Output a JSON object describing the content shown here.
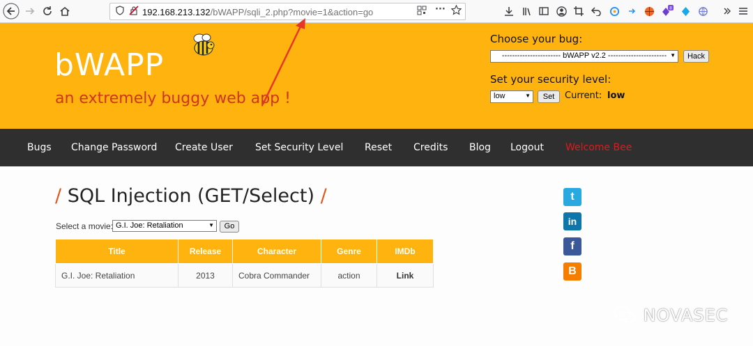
{
  "browser": {
    "url_host": "192.168.213.132",
    "url_path": "/bWAPP/sqli_2.php?movie=1&action=go",
    "badge_count": "8"
  },
  "header": {
    "logo": "bWAPP",
    "tagline": "an extremely buggy web app !",
    "choose_bug_label": "Choose your bug:",
    "bug_selected": "----------------------- bWAPP v2.2 -----------------------",
    "hack_button": "Hack",
    "security_label": "Set your security level:",
    "security_selected": "low",
    "set_button": "Set",
    "current_label": "Current:",
    "current_value": "low"
  },
  "menu": {
    "items": [
      "Bugs",
      "Change Password",
      "Create User",
      "Set Security Level",
      "Reset",
      "Credits",
      "Blog",
      "Logout"
    ],
    "welcome": "Welcome Bee"
  },
  "main": {
    "title": "SQL Injection (GET/Select)",
    "title_slash": "/",
    "select_label": "Select a movie:",
    "movie_selected": "G.I. Joe: Retaliation",
    "go_button": "Go",
    "table": {
      "headers": [
        "Title",
        "Release",
        "Character",
        "Genre",
        "IMDb"
      ],
      "rows": [
        [
          "G.I. Joe: Retaliation",
          "2013",
          "Cobra Commander",
          "action",
          "Link"
        ]
      ]
    }
  },
  "social": {
    "twitter": "t",
    "linkedin": "in",
    "facebook": "f",
    "blogger": "B"
  },
  "watermark": "NOVASEC",
  "colors": {
    "header_bg": "#ffb30f",
    "menu_bg": "#2f2f2f",
    "accent_red": "#e01a1a",
    "arrow_red": "#e8352a"
  }
}
